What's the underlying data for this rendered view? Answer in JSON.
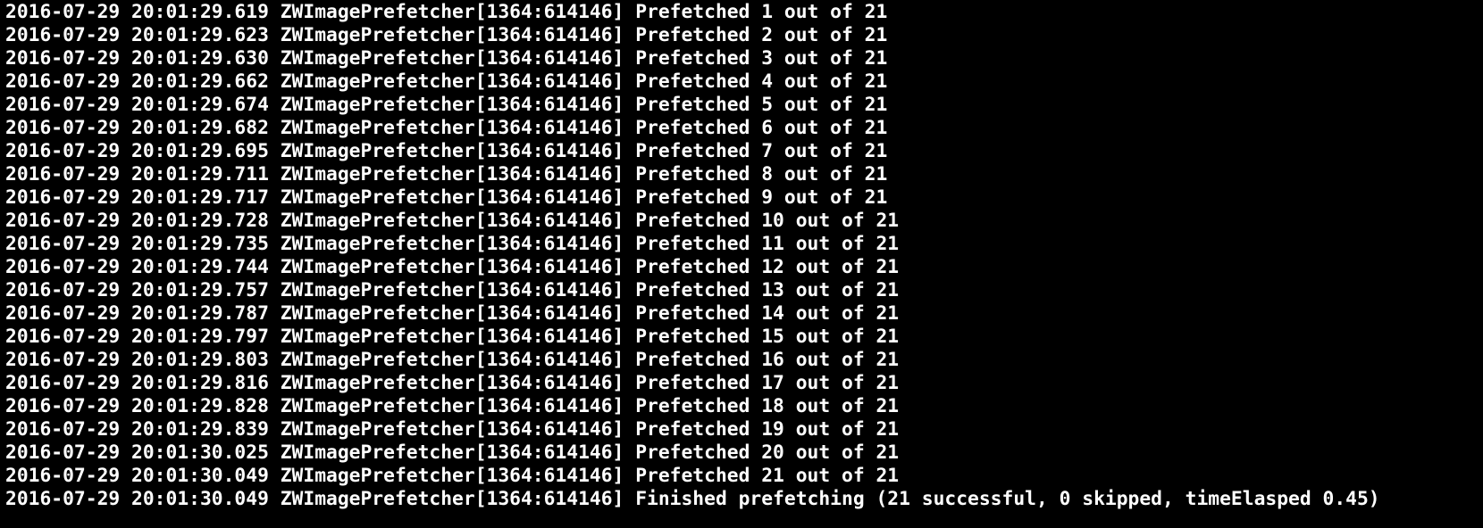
{
  "terminal": {
    "background": "#000000",
    "foreground": "#ffffff",
    "lines": [
      "2016-07-29 20:01:29.619 ZWImagePrefetcher[1364:614146] Prefetched 1 out of 21",
      "2016-07-29 20:01:29.623 ZWImagePrefetcher[1364:614146] Prefetched 2 out of 21",
      "2016-07-29 20:01:29.630 ZWImagePrefetcher[1364:614146] Prefetched 3 out of 21",
      "2016-07-29 20:01:29.662 ZWImagePrefetcher[1364:614146] Prefetched 4 out of 21",
      "2016-07-29 20:01:29.674 ZWImagePrefetcher[1364:614146] Prefetched 5 out of 21",
      "2016-07-29 20:01:29.682 ZWImagePrefetcher[1364:614146] Prefetched 6 out of 21",
      "2016-07-29 20:01:29.695 ZWImagePrefetcher[1364:614146] Prefetched 7 out of 21",
      "2016-07-29 20:01:29.711 ZWImagePrefetcher[1364:614146] Prefetched 8 out of 21",
      "2016-07-29 20:01:29.717 ZWImagePrefetcher[1364:614146] Prefetched 9 out of 21",
      "2016-07-29 20:01:29.728 ZWImagePrefetcher[1364:614146] Prefetched 10 out of 21",
      "2016-07-29 20:01:29.735 ZWImagePrefetcher[1364:614146] Prefetched 11 out of 21",
      "2016-07-29 20:01:29.744 ZWImagePrefetcher[1364:614146] Prefetched 12 out of 21",
      "2016-07-29 20:01:29.757 ZWImagePrefetcher[1364:614146] Prefetched 13 out of 21",
      "2016-07-29 20:01:29.787 ZWImagePrefetcher[1364:614146] Prefetched 14 out of 21",
      "2016-07-29 20:01:29.797 ZWImagePrefetcher[1364:614146] Prefetched 15 out of 21",
      "2016-07-29 20:01:29.803 ZWImagePrefetcher[1364:614146] Prefetched 16 out of 21",
      "2016-07-29 20:01:29.816 ZWImagePrefetcher[1364:614146] Prefetched 17 out of 21",
      "2016-07-29 20:01:29.828 ZWImagePrefetcher[1364:614146] Prefetched 18 out of 21",
      "2016-07-29 20:01:29.839 ZWImagePrefetcher[1364:614146] Prefetched 19 out of 21",
      "2016-07-29 20:01:30.025 ZWImagePrefetcher[1364:614146] Prefetched 20 out of 21",
      "2016-07-29 20:01:30.049 ZWImagePrefetcher[1364:614146] Prefetched 21 out of 21",
      "2016-07-29 20:01:30.049 ZWImagePrefetcher[1364:614146] Finished prefetching (21 successful, 0 skipped, timeElasped 0.45)"
    ]
  }
}
